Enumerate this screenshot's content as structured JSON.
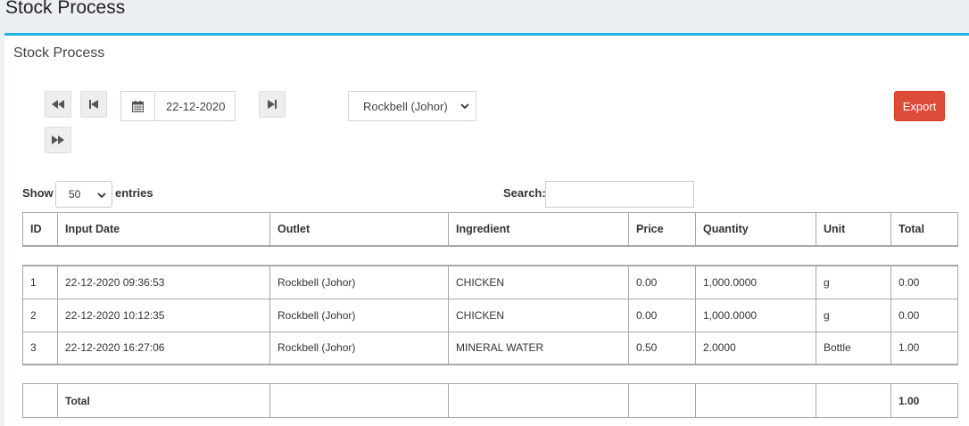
{
  "page": {
    "title": "Stock Process"
  },
  "box": {
    "title": "Stock Process"
  },
  "toolbar": {
    "date": "22-12-2020",
    "outlet": "Rockbell (Johor)",
    "export_label": "Export"
  },
  "datatable": {
    "show_label": "Show",
    "entries_value": "50",
    "entries_label": "entries",
    "search_label": "Search:",
    "columns": [
      "ID",
      "Input Date",
      "Outlet",
      "Ingredient",
      "Price",
      "Quantity",
      "Unit",
      "Total"
    ],
    "rows": [
      [
        "1",
        "22-12-2020 09:36:53",
        "Rockbell (Johor)",
        "CHICKEN",
        "0.00",
        "1,000.0000",
        "g",
        "0.00"
      ],
      [
        "2",
        "22-12-2020 10:12:35",
        "Rockbell (Johor)",
        "CHICKEN",
        "0.00",
        "1,000.0000",
        "g",
        "0.00"
      ],
      [
        "3",
        "22-12-2020 16:27:06",
        "Rockbell (Johor)",
        "MINERAL WATER",
        "0.50",
        "2.0000",
        "Bottle",
        "1.00"
      ]
    ],
    "footer": {
      "label": "Total",
      "total": "1.00"
    }
  },
  "icons": {
    "first": "fast-backward-icon",
    "prev": "step-backward-icon",
    "calendar": "calendar-icon",
    "next": "step-forward-icon",
    "last": "fast-forward-icon"
  },
  "colors": {
    "accent": "#1bb6e4",
    "export": "#dd4b39"
  }
}
